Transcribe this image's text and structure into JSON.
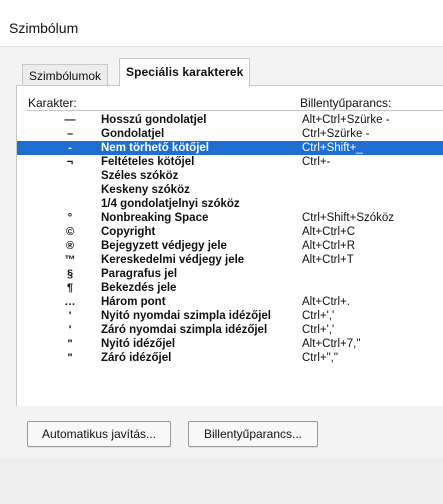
{
  "window": {
    "title": "Szimbólum"
  },
  "tabs": [
    {
      "label": "Szimbólumok",
      "active": false
    },
    {
      "label": "Speciális karakterek",
      "active": true
    }
  ],
  "columns": {
    "character": "Karakter:",
    "shortcut": "Billentyűparancs:"
  },
  "rows": [
    {
      "symbol": "—",
      "name": "Hosszú gondolatjel",
      "shortcut": "Alt+Ctrl+Szürke -"
    },
    {
      "symbol": "–",
      "name": "Gondolatjel",
      "shortcut": "Ctrl+Szürke -"
    },
    {
      "symbol": "-",
      "name": "Nem törhető kötőjel",
      "shortcut": "Ctrl+Shift+_",
      "selected": true
    },
    {
      "symbol": "¬",
      "name": "Feltételes kötőjel",
      "shortcut": "Ctrl+-"
    },
    {
      "symbol": "",
      "name": "Széles szóköz",
      "shortcut": ""
    },
    {
      "symbol": "",
      "name": "Keskeny szóköz",
      "shortcut": ""
    },
    {
      "symbol": "",
      "name": "1/4 gondolatjelnyi szóköz",
      "shortcut": ""
    },
    {
      "symbol": "°",
      "name": "Nonbreaking Space",
      "shortcut": "Ctrl+Shift+Szóköz"
    },
    {
      "symbol": "©",
      "name": "Copyright",
      "shortcut": "Alt+Ctrl+C"
    },
    {
      "symbol": "®",
      "name": "Bejegyzett védjegy jele",
      "shortcut": "Alt+Ctrl+R"
    },
    {
      "symbol": "™",
      "name": "Kereskedelmi védjegy jele",
      "shortcut": "Alt+Ctrl+T"
    },
    {
      "symbol": "§",
      "name": "Paragrafus jel",
      "shortcut": ""
    },
    {
      "symbol": "¶",
      "name": "Bekezdés jele",
      "shortcut": ""
    },
    {
      "symbol": "…",
      "name": "Három pont",
      "shortcut": "Alt+Ctrl+."
    },
    {
      "symbol": "'",
      "name": "Nyitó nyomdai szimpla idézőjel",
      "shortcut": "Ctrl+','"
    },
    {
      "symbol": "'",
      "name": "Záró nyomdai szimpla idézőjel",
      "shortcut": "Ctrl+','"
    },
    {
      "symbol": "\"",
      "name": "Nyitó idézőjel",
      "shortcut": "Alt+Ctrl+7,\""
    },
    {
      "symbol": "\"",
      "name": "Záró idézőjel",
      "shortcut": "Ctrl+\",\""
    }
  ],
  "buttons": {
    "autocorrect": "Automatikus javítás...",
    "shortcut_key": "Billentyűparancs..."
  },
  "colors": {
    "selection": "#1f6fd0"
  }
}
